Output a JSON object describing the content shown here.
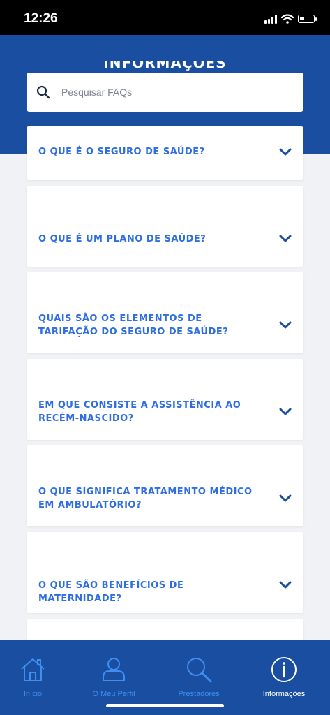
{
  "status_bar": {
    "time": "12:26"
  },
  "header": {
    "title": "INFORMAÇÕES"
  },
  "search": {
    "placeholder": "Pesquisar FAQs"
  },
  "faqs": [
    {
      "question": "O QUE É O SEGURO DE SAÚDE?"
    },
    {
      "question": "O QUE É UM PLANO DE SAÚDE?"
    },
    {
      "question": "QUAIS SÃO OS ELEMENTOS DE TARIFAÇÃO DO SEGURO DE SAÚDE?"
    },
    {
      "question": "EM QUE CONSISTE A ASSISTÊNCIA AO RECÉM-NASCIDO?"
    },
    {
      "question": "O QUE SIGNIFICA TRATAMENTO MÉDICO EM AMBULATÓRIO?"
    },
    {
      "question": "O QUE SÃO BENEFÍCIOS DE MATERNIDADE?"
    }
  ],
  "tabs": [
    {
      "label": "Início",
      "icon": "home-icon"
    },
    {
      "label": "O Meu Perfil",
      "icon": "user-icon"
    },
    {
      "label": "Prestadores",
      "icon": "search-icon"
    },
    {
      "label": "Informações",
      "icon": "info-icon",
      "active": true
    }
  ],
  "colors": {
    "brand_blue": "#1a4ea0",
    "question_blue": "#2f6ee0",
    "tab_inactive": "#3f8ef2"
  }
}
